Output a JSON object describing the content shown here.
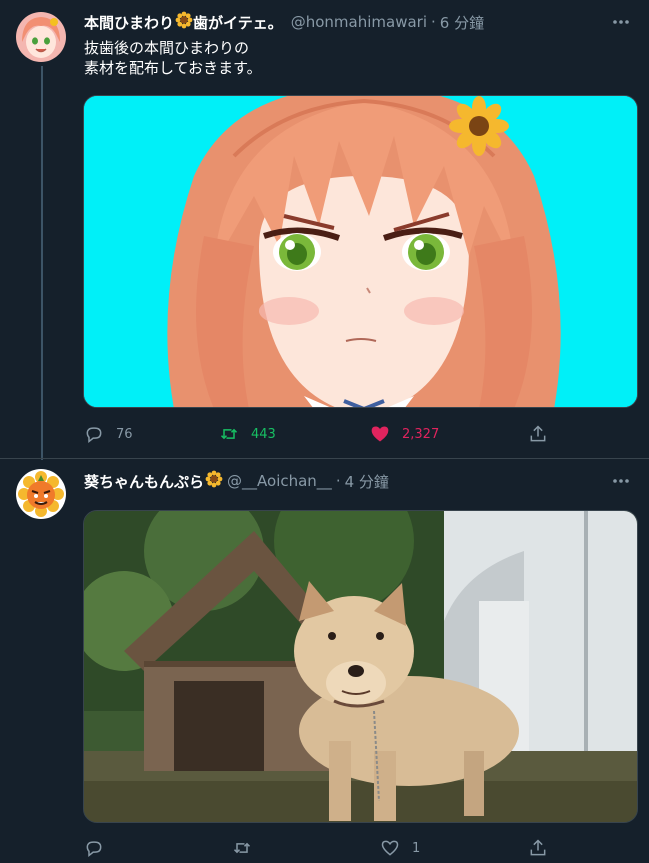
{
  "tweets": [
    {
      "display_name": "本間ひまわり",
      "name_suffix": "歯がイテェ。",
      "handle": "@honmahimawari",
      "dot": "·",
      "time": "6 分鐘",
      "text_lines": [
        "抜歯後の本間ひまわりの",
        "素材を配布しておきます。"
      ],
      "media_icon": "anime-girl-face-illustration",
      "actions": {
        "reply_count": "76",
        "retweet_count": "443",
        "like_count": "2,327"
      }
    },
    {
      "display_name": "葵ちゃんもんぷら",
      "handle": "@__Aoichan__",
      "dot": "·",
      "time": "4 分鐘",
      "media_icon": "shiba-dog-in-front-of-doghouse-photo",
      "actions": {
        "like_count": "1"
      }
    }
  ],
  "colors": {
    "background": "#15202b",
    "secondary_text": "#8899a6",
    "retweeted": "#17bf63",
    "liked": "#e0245e",
    "media_bg_cyan": "#00f0f8"
  }
}
